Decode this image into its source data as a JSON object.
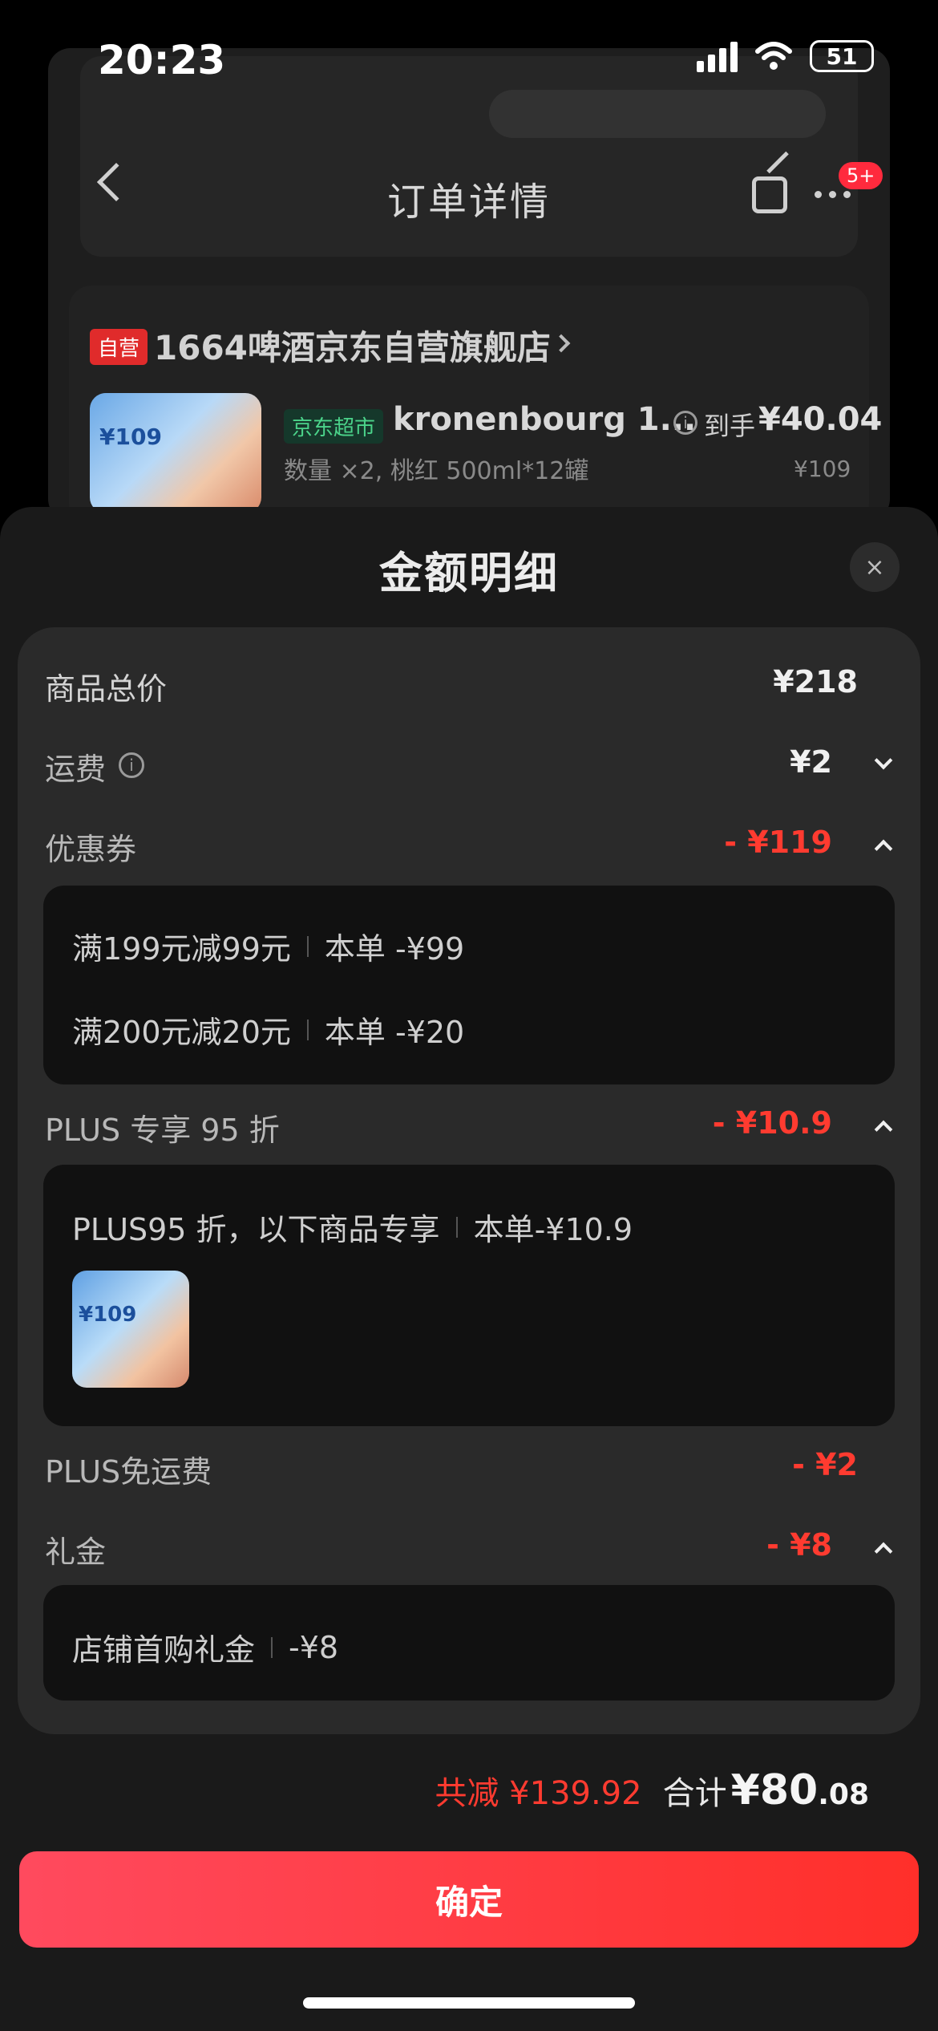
{
  "status_bar": {
    "time": "20:23",
    "battery": "51"
  },
  "background_page": {
    "nav_title": "订单详情",
    "more_badge": "5+",
    "store": {
      "badge": "自营",
      "name": "1664啤酒京东自营旗舰店"
    },
    "product": {
      "image_price": "¥109",
      "tag": "京东超市",
      "name": "kronenbourg 1...",
      "spec": "数量 ×2, 桃红 500ml*12罐",
      "final_label": "到手",
      "final_price": "¥40.04",
      "original_price": "¥109"
    }
  },
  "sheet": {
    "title": "金额明细",
    "close_icon": "×",
    "rows": {
      "goods_total": {
        "label": "商品总价",
        "value": "¥218"
      },
      "shipping": {
        "label": "运费",
        "info": "i",
        "value": "¥2"
      },
      "coupon": {
        "label": "优惠券",
        "value": "- ¥119"
      },
      "plus_discount": {
        "label": "PLUS 专享 95 折",
        "value": "- ¥10.9"
      },
      "plus_free_shipping": {
        "label": "PLUS免运费",
        "value": "- ¥2"
      },
      "gift_money": {
        "label": "礼金",
        "value": "- ¥8"
      }
    },
    "coupon_details": [
      {
        "text": "满199元减99元",
        "amount": "本单 -¥99"
      },
      {
        "text": "满200元减20元",
        "amount": "本单 -¥20"
      }
    ],
    "plus_detail": {
      "text": "PLUS95 折，以下商品专享",
      "amount": "本单-¥10.9",
      "thumb_price": "¥109"
    },
    "gift_detail": {
      "text": "店铺首购礼金",
      "amount": "-¥8"
    }
  },
  "footer": {
    "reduced": "共减 ¥139.92",
    "total_label": "合计",
    "total_value": "¥80",
    "total_cents": ".08",
    "confirm": "确定"
  },
  "colors": {
    "accent_red": "#ff3b30",
    "button_start": "#ff4a5e",
    "button_end": "#ff2f2a"
  }
}
